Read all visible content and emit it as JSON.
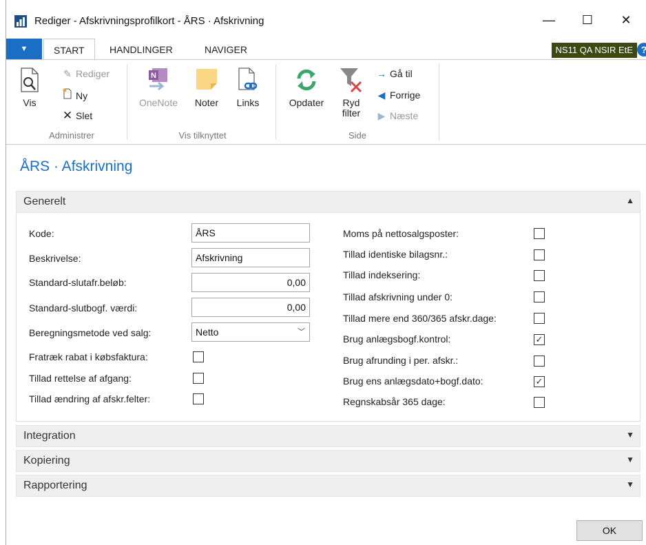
{
  "window": {
    "title": "Rediger - Afskrivningsprofilkort - ÅRS · Afskrivning",
    "minimize_label": "—",
    "maximize_label": "☐",
    "close_label": "✕"
  },
  "ribbon_tabs": {
    "file_label": "▼",
    "tabs": [
      "START",
      "HANDLINGER",
      "NAVIGER"
    ],
    "company": "NS11 QA NSIR EtE",
    "help_label": "?"
  },
  "ribbon": {
    "groups": {
      "administrer": "Administrer",
      "vis_tilknyttet": "Vis tilknyttet",
      "side": "Side"
    },
    "buttons": {
      "vis": "Vis",
      "rediger": "Rediger",
      "ny": "Ny",
      "slet": "Slet",
      "onenote": "OneNote",
      "noter": "Noter",
      "links": "Links",
      "opdater": "Opdater",
      "ryd_filter_1": "Ryd",
      "ryd_filter_2": "filter",
      "ga_til": "Gå til",
      "forrige": "Forrige",
      "naeste": "Næste"
    }
  },
  "page": {
    "title": "ÅRS · Afskrivning",
    "tabs": {
      "generelt": "Generelt",
      "integration": "Integration",
      "kopiering": "Kopiering",
      "rapportering": "Rapportering"
    },
    "general": {
      "kode_label": "Kode:",
      "kode_value": "ÅRS",
      "beskrivelse_label": "Beskrivelse:",
      "beskrivelse_value": "Afskrivning",
      "std_slutafr_label": "Standard-slutafr.beløb:",
      "std_slutafr_value": "0,00",
      "std_slutbogf_label": "Standard-slutbogf. værdi:",
      "std_slutbogf_value": "0,00",
      "beregning_label": "Beregningsmetode ved salg:",
      "beregning_value": "Netto",
      "fraek_label": "Fratræk rabat i købsfaktura:",
      "fraek_checked": false,
      "rettelse_label": "Tillad rettelse af afgang:",
      "rettelse_checked": false,
      "aendring_label": "Tillad ændring af afskr.felter:",
      "aendring_checked": false
    },
    "right": [
      {
        "label": "Moms på nettosalgsposter:",
        "checked": false
      },
      {
        "label": "Tillad identiske bilagsnr.:",
        "checked": false
      },
      {
        "label": "Tillad indeksering:",
        "checked": false
      },
      {
        "label": "Tillad afskrivning under 0:",
        "checked": false
      },
      {
        "label": "Tillad mere end 360/365 afskr.dage:",
        "checked": false
      },
      {
        "label": "Brug anlægsbogf.kontrol:",
        "checked": true
      },
      {
        "label": "Brug afrunding i per. afskr.:",
        "checked": false
      },
      {
        "label": "Brug ens anlægsdato+bogf.dato:",
        "checked": true
      },
      {
        "label": "Regnskabsår 365 dage:",
        "checked": false
      }
    ]
  },
  "footer": {
    "ok_label": "OK"
  },
  "icons": {
    "chevron_up": "▲",
    "chevron_down": "▼",
    "check": "✓"
  }
}
